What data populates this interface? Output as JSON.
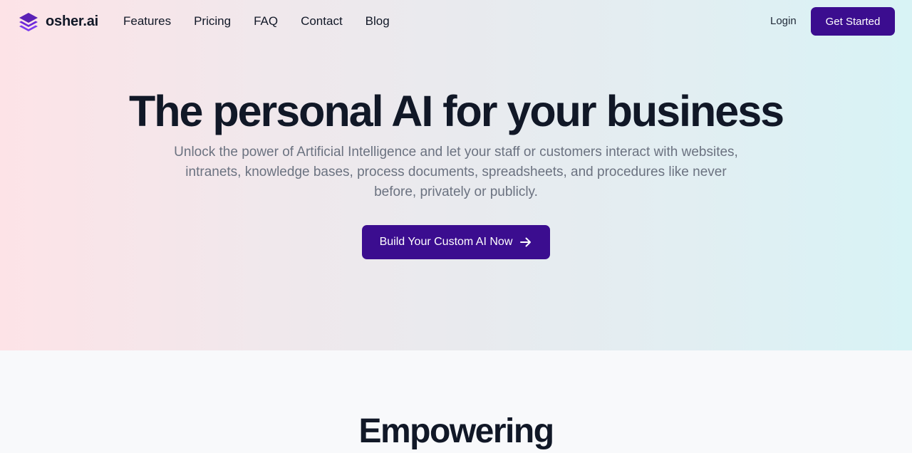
{
  "brand": {
    "name": "osher.ai",
    "logo_icon": "stacked-layers-icon",
    "accent_color": "#3b0d8f"
  },
  "nav": {
    "links": [
      "Features",
      "Pricing",
      "FAQ",
      "Contact",
      "Blog"
    ],
    "login_label": "Login",
    "get_started_label": "Get Started"
  },
  "hero": {
    "headline": "The personal AI for your business",
    "subtitle": "Unlock the power of Artificial Intelligence and let your staff or customers interact with websites, intranets, knowledge bases, process documents, spreadsheets, and procedures like never before, privately or publicly.",
    "cta_label": "Build Your Custom AI Now",
    "cta_icon": "arrow-right-icon"
  },
  "next_section": {
    "title": "Empowering"
  }
}
